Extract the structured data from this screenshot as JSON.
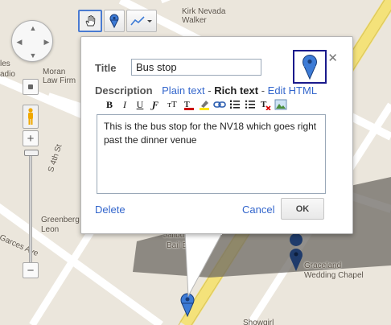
{
  "map": {
    "labels": {
      "kirk_nevada_walker": "Kirk Nevada\nWalker",
      "les": "les",
      "adio": "adio",
      "moran": "Moran",
      "law_firm": "Law Firm",
      "street_s4th": "S 4th St",
      "greenberg": "Greenberg",
      "leon": "Leon",
      "garces_ave": "Garces Ave",
      "jailbusters": "Jailbusters",
      "bail_bonds": "Bail Bonds",
      "graceland": "Graceland",
      "wedding_chapel": "Wedding Chapel",
      "showgirl": "Showgirl"
    },
    "accent_color": "#3366cc",
    "marker_color": "#3d7bd6"
  },
  "toolbar": {
    "hand_tool": "hand-icon",
    "marker_tool": "placemark-icon",
    "line_tool": "line-icon"
  },
  "dialog": {
    "title_label": "Title",
    "title_value": "Bus stop",
    "description_label": "Description",
    "mode_plain": "Plain text",
    "mode_rich": "Rich text",
    "mode_html": "Edit HTML",
    "sep": " - ",
    "rte": {
      "bold": "B",
      "italic": "I",
      "underline": "U",
      "font": "Ƒ",
      "size": "тT"
    },
    "description_text": "This is the bus stop for the NV18 which goes right past the dinner venue",
    "delete_label": "Delete",
    "cancel_label": "Cancel",
    "ok_label": "OK",
    "close_label": "✕"
  }
}
